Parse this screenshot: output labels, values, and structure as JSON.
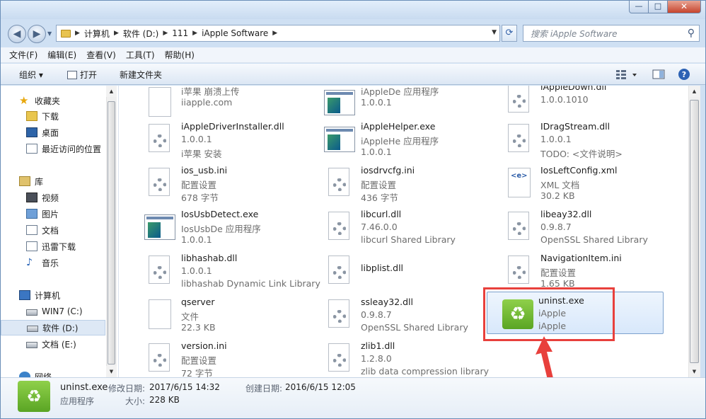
{
  "window": {
    "min": "—",
    "max": "□",
    "close": "✕"
  },
  "nav": {
    "back": "◀",
    "forward": "▶"
  },
  "address": {
    "crumbs": [
      "计算机",
      "软件 (D:)",
      "111",
      "iApple Software"
    ]
  },
  "search": {
    "placeholder": "搜索 iApple Software"
  },
  "menu": [
    "文件(F)",
    "编辑(E)",
    "查看(V)",
    "工具(T)",
    "帮助(H)"
  ],
  "toolbar": {
    "organize": "组织 ▾",
    "open": "打开",
    "new_folder": "新建文件夹",
    "help": "?"
  },
  "sidebar": {
    "favorites": "收藏夹",
    "downloads": "下载",
    "desktop": "桌面",
    "recent": "最近访问的位置",
    "libraries": "库",
    "video": "视频",
    "pictures": "图片",
    "documents": "文档",
    "xunlei": "迅雷下载",
    "music": "音乐",
    "computer": "计算机",
    "drive_c": "WIN7 (C:)",
    "drive_d": "软件 (D:)",
    "drive_e": "文档 (E:)",
    "network": "网络"
  },
  "files": [
    {
      "name": "i苹果 崩溃上传",
      "l2": "iiapple.com",
      "l3": ""
    },
    {
      "name": "iAppleDe 应用程序",
      "l2": "1.0.0.1",
      "l3": ""
    },
    {
      "name": "iAppleDown.dll",
      "l2": "1.0.0.1010",
      "l3": ""
    },
    {
      "name": "iAppleDriverInstaller.dll",
      "l2": "1.0.0.1",
      "l3": "i苹果 安装"
    },
    {
      "name": "iAppleHelper.exe",
      "l2": "iAppleHe 应用程序",
      "l3": "1.0.0.1"
    },
    {
      "name": "IDragStream.dll",
      "l2": "1.0.0.1",
      "l3": "TODO: <文件说明>"
    },
    {
      "name": "ios_usb.ini",
      "l2": "配置设置",
      "l3": "678 字节"
    },
    {
      "name": "iosdrvcfg.ini",
      "l2": "配置设置",
      "l3": "436 字节"
    },
    {
      "name": "IosLeftConfig.xml",
      "l2": "XML 文档",
      "l3": "30.2 KB"
    },
    {
      "name": "IosUsbDetect.exe",
      "l2": "IosUsbDe 应用程序",
      "l3": "1.0.0.1"
    },
    {
      "name": "libcurl.dll",
      "l2": "7.46.0.0",
      "l3": "libcurl Shared Library"
    },
    {
      "name": "libeay32.dll",
      "l2": "0.9.8.7",
      "l3": "OpenSSL Shared Library"
    },
    {
      "name": "libhashab.dll",
      "l2": "1.0.0.1",
      "l3": "libhashab Dynamic Link Library"
    },
    {
      "name": "libplist.dll",
      "l2": "",
      "l3": ""
    },
    {
      "name": "NavigationItem.ini",
      "l2": "配置设置",
      "l3": "1.65 KB"
    },
    {
      "name": "qserver",
      "l2": "文件",
      "l3": "22.3 KB"
    },
    {
      "name": "ssleay32.dll",
      "l2": "0.9.8.7",
      "l3": "OpenSSL Shared Library"
    },
    {
      "name": "uninst.exe",
      "l2": "iApple",
      "l3": "iApple"
    },
    {
      "name": "version.ini",
      "l2": "配置设置",
      "l3": "72 字节"
    },
    {
      "name": "zlib1.dll",
      "l2": "1.2.8.0",
      "l3": "zlib data compression library"
    }
  ],
  "status": {
    "name": "uninst.exe",
    "modified_label": "修改日期:",
    "modified": "2017/6/15 14:32",
    "created_label": "创建日期:",
    "created": "2016/6/15 12:05",
    "type": "应用程序",
    "size_label": "大小:",
    "size": "228 KB"
  },
  "icons": {
    "recycle": "♻",
    "search": "⚲",
    "refresh": "⟳"
  }
}
